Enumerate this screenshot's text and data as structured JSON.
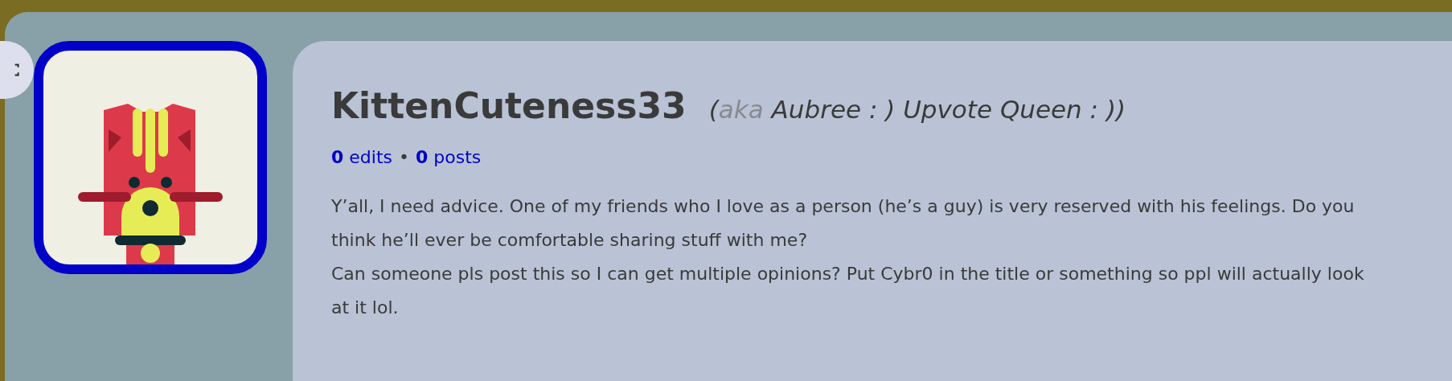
{
  "profile": {
    "username": "KittenCuteness33",
    "alias_open": "(",
    "aka_label": "aka",
    "alias": "Aubree : ) Upvote Queen : ))",
    "stats": [
      {
        "text": "**0** edits"
      },
      {
        "text": "**0** posts"
      }
    ],
    "stats_separator": "•",
    "bio": [
      "Y’all, I need advice. One of my friends who I love as a person (he’s a guy) is very reserved with his feelings. Do you think he’ll ever be comfortable sharing stuff with me?",
      "Can someone pls post this so I can get multiple opinions? Put Cybr0 in the title or something so ppl will actually look at it lol."
    ]
  }
}
